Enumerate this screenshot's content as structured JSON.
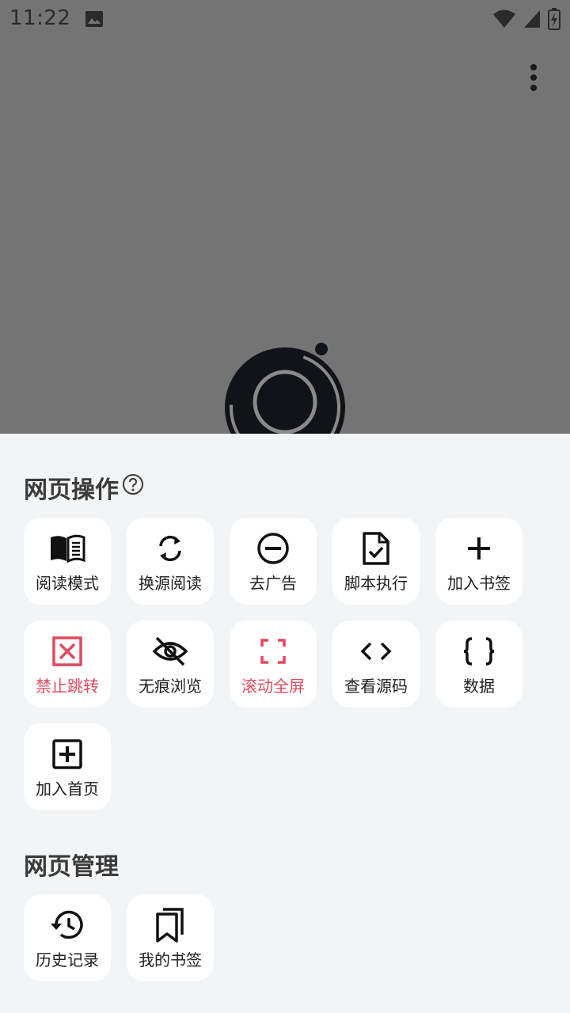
{
  "status_bar": {
    "time": "11:22",
    "icons": [
      "image-icon",
      "wifi-icon",
      "signal-icon",
      "battery-charging-icon"
    ]
  },
  "toolbar": {
    "more_icon": "more-vertical-icon"
  },
  "sheet": {
    "section1": {
      "title": "网页操作",
      "help_icon": "help-circle-icon",
      "items": [
        {
          "label": "阅读模式",
          "icon": "book-open-icon",
          "color": "#1f1f1f"
        },
        {
          "label": "换源阅读",
          "icon": "refresh-icon",
          "color": "#1f1f1f"
        },
        {
          "label": "去广告",
          "icon": "minus-circle-icon",
          "color": "#1f1f1f"
        },
        {
          "label": "脚本执行",
          "icon": "file-check-icon",
          "color": "#1f1f1f"
        },
        {
          "label": "加入书签",
          "icon": "plus-icon",
          "color": "#1f1f1f"
        },
        {
          "label": "禁止跳转",
          "icon": "x-square-icon",
          "color": "#e04a5f"
        },
        {
          "label": "无痕浏览",
          "icon": "eye-off-icon",
          "color": "#1f1f1f"
        },
        {
          "label": "滚动全屏",
          "icon": "fullscreen-icon",
          "color": "#e04a5f"
        },
        {
          "label": "查看源码",
          "icon": "code-icon",
          "color": "#1f1f1f"
        },
        {
          "label": "数据",
          "icon": "braces-icon",
          "color": "#1f1f1f"
        },
        {
          "label": "加入首页",
          "icon": "plus-square-icon",
          "color": "#1f1f1f"
        }
      ]
    },
    "section2": {
      "title": "网页管理",
      "items": [
        {
          "label": "历史记录",
          "icon": "history-icon",
          "color": "#1f1f1f"
        },
        {
          "label": "我的书签",
          "icon": "bookmarks-icon",
          "color": "#1f1f1f"
        }
      ]
    }
  },
  "colors": {
    "accent_red": "#e04a5f",
    "sheet_bg": "#f3f4f6",
    "scrim": "#747474"
  }
}
